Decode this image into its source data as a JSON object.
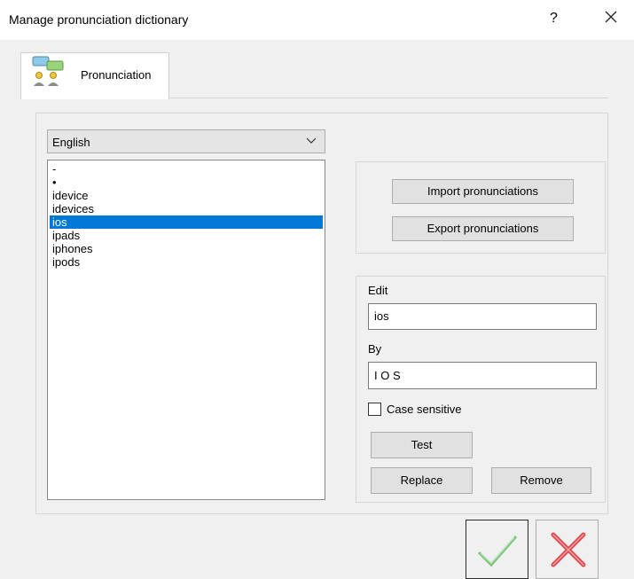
{
  "window": {
    "title": "Manage pronunciation dictionary",
    "help_symbol": "?",
    "close_symbol": "✕"
  },
  "tabs": [
    {
      "label": "Pronunciation",
      "icon": "people-chat-icon"
    }
  ],
  "language_select": {
    "value": "English"
  },
  "word_list": {
    "items": [
      "-",
      "•",
      "idevice",
      "idevices",
      "ios",
      "ipads",
      "iphones",
      "ipods"
    ],
    "selected": "ios"
  },
  "import_export": {
    "import_label": "Import pronunciations",
    "export_label": "Export pronunciations"
  },
  "editor": {
    "edit_label": "Edit",
    "edit_value": "ios",
    "by_label": "By",
    "by_value": "I O S",
    "case_sensitive_label": "Case sensitive",
    "case_sensitive_checked": false,
    "test_label": "Test",
    "replace_label": "Replace",
    "remove_label": "Remove"
  },
  "dialog_buttons": {
    "ok_icon": "green-checkmark-icon",
    "cancel_icon": "red-x-icon"
  },
  "colors": {
    "selection": "#0078d7",
    "ok_green": "#8fce8f",
    "cancel_red": "#e0484b"
  }
}
